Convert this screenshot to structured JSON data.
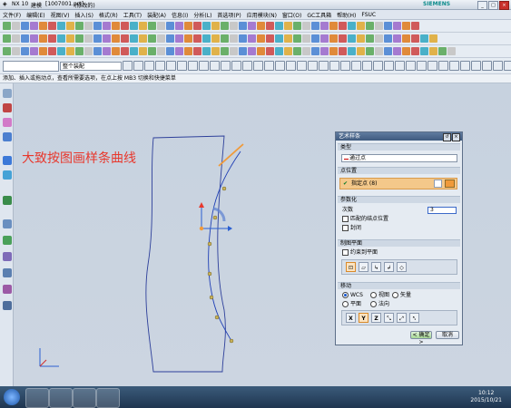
{
  "app": {
    "version": "NX 10",
    "mode": "建模",
    "file": "[1007001.prt]",
    "status": "(修改的)",
    "brand": "SIEMENS"
  },
  "menu": [
    "文件(F)",
    "编辑(E)",
    "视图(V)",
    "插入(S)",
    "格式(R)",
    "工具(T)",
    "装配(A)",
    "信息(I)",
    "分析(L)",
    "首选项(P)",
    "应用模块(N)",
    "窗口(O)",
    "GC工具箱",
    "帮助(H)",
    "FSUC"
  ],
  "toolbar3": {
    "filter_select": "",
    "scope_select": "整个装配"
  },
  "prompt": "添加、插入或拖动点，查看所需要选项，在点上按 MB3 切换和快捷菜单",
  "annotation": "大致按图画样条曲线",
  "dialog": {
    "title": "艺术样条",
    "type_section": "类型",
    "type_value": "通过点",
    "point_section": "点位置",
    "point_label": "指定点 (8)",
    "param_section": "参数化",
    "degree_label": "次数",
    "degree_value": "3",
    "match_knots": "匹配的结点位置",
    "closed": "封闭",
    "plane_section": "制图平面",
    "constrain_plane": "约束到平面",
    "move_section": "移动",
    "radio_wcs": "WCS",
    "radio_view": "视图",
    "radio_vector": "矢量",
    "radio_plane": "平面",
    "radio_normal": "法向",
    "axis_x": "X",
    "axis_y": "Y",
    "axis_z": "Z",
    "ok": "< 确定 >",
    "cancel": "取消"
  },
  "taskbar": {
    "time": "10:12",
    "date": "2015/10/21"
  },
  "colors": {
    "spline": "#1f3fb5",
    "curve": "#2d3f9a",
    "annotation": "#e8382d",
    "header": "#4a668c"
  }
}
